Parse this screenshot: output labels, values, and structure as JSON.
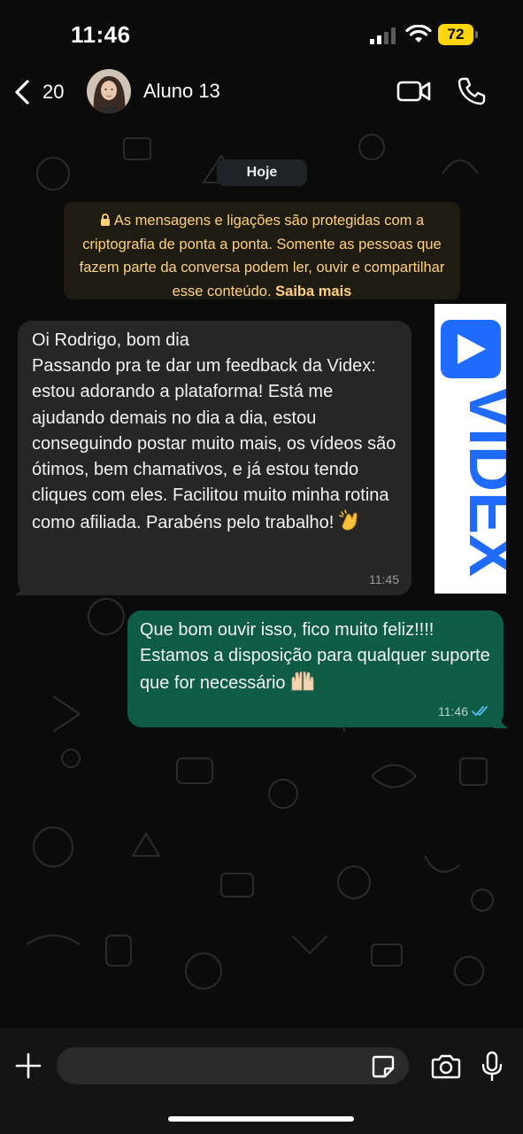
{
  "status_bar": {
    "time": "11:46",
    "battery": "72",
    "battery_color": "#ffd60a"
  },
  "header": {
    "back_count": "20",
    "contact_name": "Aluno 13"
  },
  "chat": {
    "date_chip": "Hoje",
    "encryption_text": "As mensagens e ligações são protegidas com a criptografia de ponta a ponta. Somente as pessoas que fazem parte da conversa podem ler, ouvir e compartilhar esse conteúdo.",
    "encryption_link": "Saiba mais",
    "incoming": {
      "text": "Oi Rodrigo, bom dia\nPassando pra te dar um feedback da Videx: estou adorando a plataforma! Está me ajudando demais no dia a dia, estou conseguindo postar muito mais, os vídeos são ótimos, bem chamativos, e já estou tendo cliques com eles. Facilitou muito minha rotina como afiliada. Parabéns pelo trabalho!",
      "emoji": "clapping-hands",
      "time": "11:45"
    },
    "outgoing": {
      "text": "Que bom ouvir isso, fico muito feliz!!!!\nEstamos a disposição para qualquer suporte que for necessário",
      "emoji": "raising-hands",
      "time": "11:46",
      "read": true
    },
    "overlay_logo": {
      "text": "VIDEX",
      "color": "#1f6bff"
    }
  },
  "colors": {
    "incoming_bubble": "#262626",
    "outgoing_bubble": "#0f5c46",
    "encryption_text": "#ffd279",
    "read_ticks": "#53bdeb"
  }
}
